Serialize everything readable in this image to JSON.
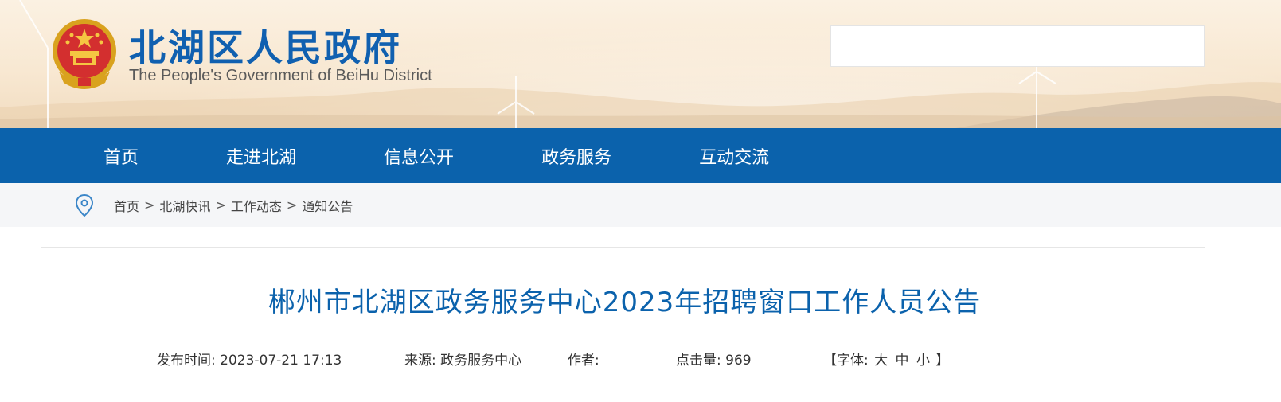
{
  "header": {
    "site_title": "北湖区人民政府",
    "site_subtitle": "The People's Government of BeiHu District",
    "search_value": ""
  },
  "nav": {
    "items": [
      {
        "label": "首页"
      },
      {
        "label": "走进北湖"
      },
      {
        "label": "信息公开"
      },
      {
        "label": "政务服务"
      },
      {
        "label": "互动交流"
      }
    ]
  },
  "breadcrumb": {
    "items": [
      "首页",
      "北湖快讯",
      "工作动态",
      "通知公告"
    ],
    "separator": ">"
  },
  "article": {
    "title": "郴州市北湖区政务服务中心2023年招聘窗口工作人员公告",
    "publish_label": "发布时间:",
    "publish_value": "2023-07-21 17:13",
    "source_label": "来源:",
    "source_value": "政务服务中心",
    "author_label": "作者:",
    "author_value": "",
    "hits_label": "点击量:",
    "hits_value": "969",
    "font_open": "【字体:",
    "font_large": "大",
    "font_medium": "中",
    "font_small": "小",
    "font_close": "】"
  },
  "colors": {
    "brand_blue": "#0b62ac",
    "breadcrumb_bg": "#f5f6f8"
  },
  "icons": {
    "emblem": "national-emblem-icon",
    "breadcrumb": "location-pin-icon"
  }
}
